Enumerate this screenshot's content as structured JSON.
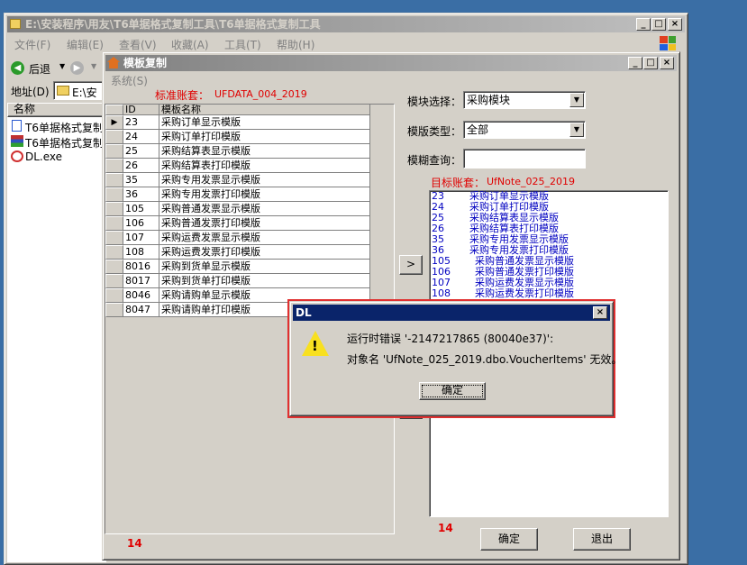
{
  "explorer": {
    "title": "E:\\安装程序\\用友\\T6单据格式复制工具\\T6单据格式复制工具",
    "menu": [
      "文件(F)",
      "编辑(E)",
      "查看(V)",
      "收藏(A)",
      "工具(T)",
      "帮助(H)"
    ],
    "back_label": "后退",
    "address_label": "地址(D)",
    "address_value": "E:\\安",
    "column_name": "名称",
    "files": [
      {
        "name": "T6单据格式复制",
        "icon": "doc-icon"
      },
      {
        "name": "T6单据格式复制",
        "icon": "rar-icon"
      },
      {
        "name": "DL.exe",
        "icon": "exe-icon"
      }
    ]
  },
  "app": {
    "title": "模板复制",
    "menu_system": "系统(S)",
    "source_label": "标准账套：",
    "source_account": "UFDATA_004_2019",
    "grid_headers": {
      "id": "ID",
      "name": "模板名称"
    },
    "source_rows": [
      {
        "id": "23",
        "name": "采购订单显示模版"
      },
      {
        "id": "24",
        "name": "采购订单打印模版"
      },
      {
        "id": "25",
        "name": "采购结算表显示模版"
      },
      {
        "id": "26",
        "name": "采购结算表打印模版"
      },
      {
        "id": "35",
        "name": "采购专用发票显示模版"
      },
      {
        "id": "36",
        "name": "采购专用发票打印模版"
      },
      {
        "id": "105",
        "name": "采购普通发票显示模版"
      },
      {
        "id": "106",
        "name": "采购普通发票打印模版"
      },
      {
        "id": "107",
        "name": "采购运费发票显示模版"
      },
      {
        "id": "108",
        "name": "采购运费发票打印模版"
      },
      {
        "id": "8016",
        "name": "采购到货单显示模版"
      },
      {
        "id": "8017",
        "name": "采购到货单打印模版"
      },
      {
        "id": "8046",
        "name": "采购请购单显示模版"
      },
      {
        "id": "8047",
        "name": "采购请购单打印模版"
      }
    ],
    "module_label": "模块选择：",
    "module_value": "采购模块",
    "type_label": "模版类型：",
    "type_value": "全部",
    "query_label": "模糊查询：",
    "query_value": "",
    "target_label": "目标账套：",
    "target_account": "UfNote_025_2019",
    "target_rows": [
      {
        "id": "23",
        "name": "采购订单显示模版"
      },
      {
        "id": "24",
        "name": "采购订单打印模版"
      },
      {
        "id": "25",
        "name": "采购结算表显示模版"
      },
      {
        "id": "26",
        "name": "采购结算表打印模版"
      },
      {
        "id": "35",
        "name": "采购专用发票显示模版"
      },
      {
        "id": "36",
        "name": "采购专用发票打印模版"
      },
      {
        "id": "105",
        "name": "采购普通发票显示模版"
      },
      {
        "id": "106",
        "name": "采购普通发票打印模版"
      },
      {
        "id": "107",
        "name": "采购运费发票显示模版"
      },
      {
        "id": "108",
        "name": "采购运费发票打印模版"
      }
    ],
    "copy_arrow": ">",
    "source_count": "14",
    "target_count": "14",
    "ok_label": "确定",
    "exit_label": "退出"
  },
  "dialog": {
    "title": "DL",
    "line1": "运行时错误 '-2147217865 (80040e37)':",
    "line2": "对象名 'UfNote_025_2019.dbo.VoucherItems' 无效。",
    "ok_label": "确定"
  },
  "colors": {
    "highlight_border": "#e03030",
    "title_active": "#0a246a",
    "desktop": "#3a6ea5"
  }
}
